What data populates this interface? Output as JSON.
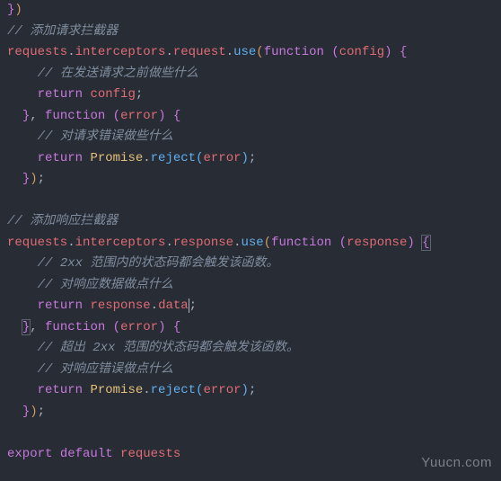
{
  "code": {
    "l1a": "}",
    "l1b": ")",
    "c1": "// 添加请求拦截器",
    "l2_requests": "requests",
    "l2_interceptors": "interceptors",
    "l2_request": "request",
    "l2_use": "use",
    "l2_function": "function",
    "l2_config": "config",
    "c2": "// 在发送请求之前做些什么",
    "l3_return": "return",
    "l3_config": "config",
    "l4_function": "function",
    "l4_error": "error",
    "c3": "// 对请求错误做些什么",
    "l5_return": "return",
    "l5_promise": "Promise",
    "l5_reject": "reject",
    "l5_error": "error",
    "c4": "// 添加响应拦截器",
    "l7_requests": "requests",
    "l7_interceptors": "interceptors",
    "l7_response": "response",
    "l7_use": "use",
    "l7_function": "function",
    "l7_responseParam": "response",
    "c5": "// 2xx 范围内的状态码都会触发该函数。",
    "c6": "// 对响应数据做点什么",
    "l8_return": "return",
    "l8_response": "response",
    "l8_data": "data",
    "l9_function": "function",
    "l9_error": "error",
    "c7": "// 超出 2xx 范围的状态码都会触发该函数。",
    "c8": "// 对响应错误做点什么",
    "l10_return": "return",
    "l10_promise": "Promise",
    "l10_reject": "reject",
    "l10_error": "error",
    "l11_export": "export",
    "l11_default": "default",
    "l11_requests": "requests"
  },
  "watermark": "Yuucn.com"
}
